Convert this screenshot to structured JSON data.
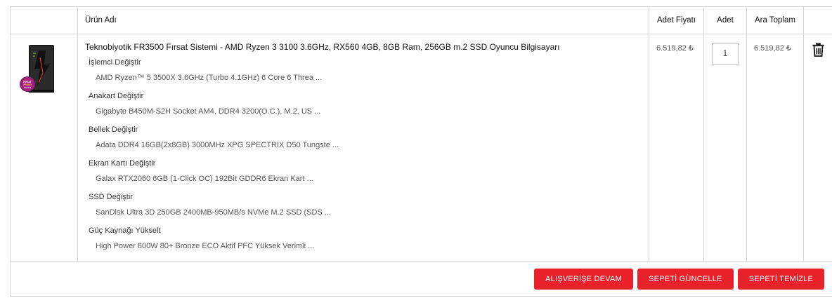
{
  "table": {
    "headers": {
      "product_name": "Ürün Adı",
      "unit_price": "Adet Fiyatı",
      "quantity": "Adet",
      "subtotal": "Ara Toplam"
    }
  },
  "item": {
    "title": "Teknobiyotik FR3500 Fırsat Sistemi - AMD Ryzen 3 3100 3.6GHz, RX560 4GB, 8GB Ram, 256GB m.2 SSD Oyuncu Bilgisayarı",
    "image_badge": "FIRSAT FR3500 SİSTEM",
    "unit_price": "6.519,82 ₺",
    "quantity": "1",
    "subtotal": "6.519,82 ₺",
    "options": [
      {
        "title": "İşlemci Değiştir",
        "value": "AMD Ryzen™ 5 3500X 3.6GHz (Turbo 4.1GHz) 6 Core 6 Threa ..."
      },
      {
        "title": "Anakart Değiştir",
        "value": "Gigabyte B450M-S2H Socket AM4, DDR4 3200(O.C.), M.2, US ..."
      },
      {
        "title": "Bellek Değiştir",
        "value": "Adata DDR4 16GB(2x8GB) 3000MHz XPG SPECTRIX D50 Tungste ..."
      },
      {
        "title": "Ekran Kartı Değiştir",
        "value": "Galax RTX2060 6GB (1-Click OC) 192Bit GDDR6 Ekran Kart ..."
      },
      {
        "title": "SSD Değiştir",
        "value": "SanDisk Ultra 3D 250GB 2400MB-950MB/s NVMe M.2 SSD (SDS ..."
      },
      {
        "title": "Güç Kaynağı Yükselt",
        "value": "High Power 600W 80+ Bronze ECO Aktif PFC Yüksek Verimli ..."
      }
    ]
  },
  "actions": {
    "continue_shopping": "ALIŞVERİŞE DEVAM",
    "update_cart": "SEPETİ GÜNCELLE",
    "clear_cart": "SEPETİ TEMİZLE"
  },
  "icons": {
    "delete": "trash-icon"
  },
  "colors": {
    "button": "#e8212b",
    "border": "#d6d6d6"
  }
}
